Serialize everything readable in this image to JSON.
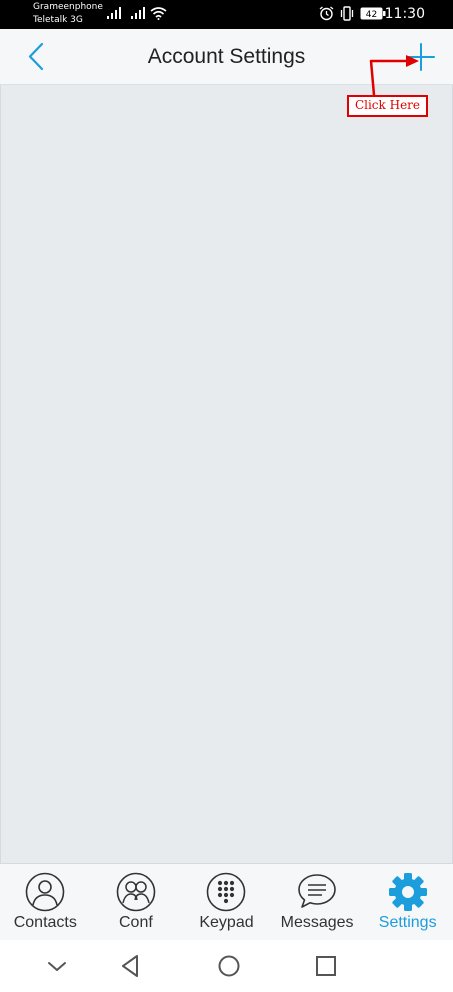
{
  "status_bar": {
    "carrier_1": "Grameenphone",
    "carrier_2": "Teletalk 3G",
    "battery_level": "42",
    "time": "11:30"
  },
  "header": {
    "title": "Account Settings"
  },
  "annotation": {
    "label": "Click Here",
    "color": "#e00000"
  },
  "bottom_nav": {
    "items": [
      {
        "label": "Contacts",
        "icon": "person-icon",
        "active": false
      },
      {
        "label": "Conf",
        "icon": "group-icon",
        "active": false
      },
      {
        "label": "Keypad",
        "icon": "keypad-icon",
        "active": false
      },
      {
        "label": "Messages",
        "icon": "chat-bubble-icon",
        "active": false
      },
      {
        "label": "Settings",
        "icon": "gear-icon",
        "active": true
      }
    ]
  },
  "colors": {
    "accent": "#1c9ddc",
    "content_background": "#e7ebee",
    "header_background": "#f6f7f9"
  }
}
